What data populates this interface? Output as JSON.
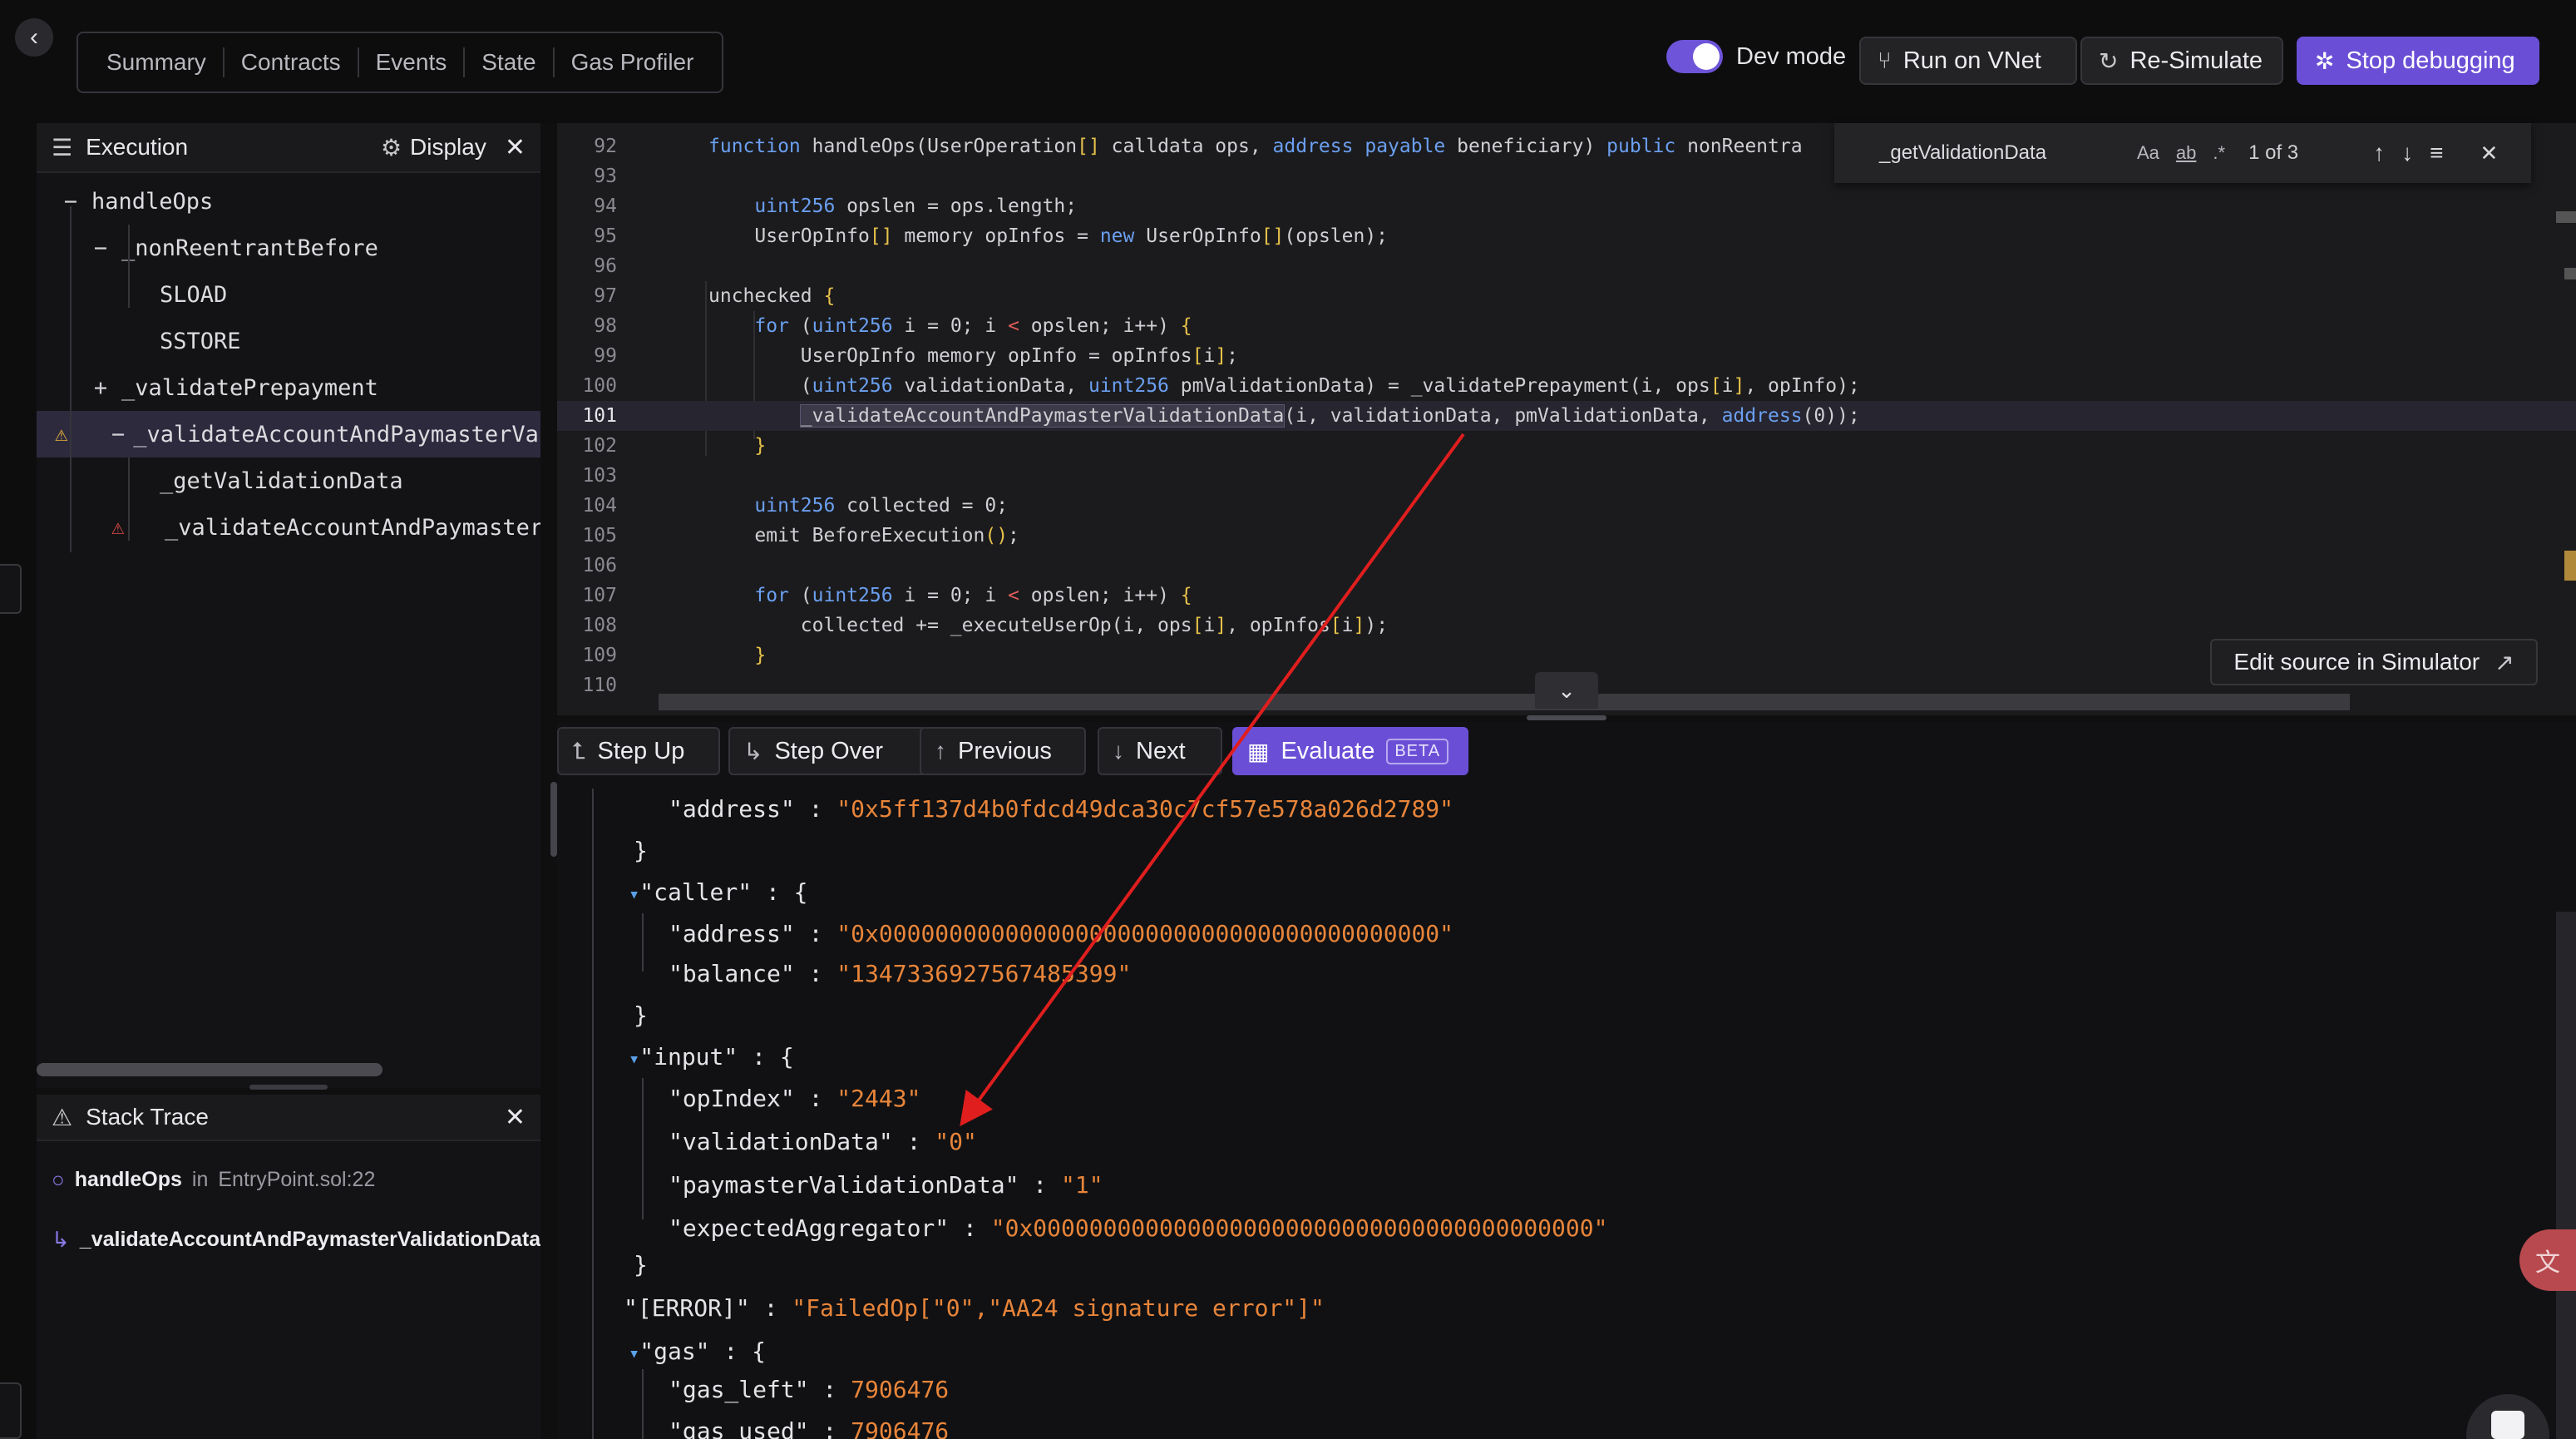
{
  "tabs": [
    "Summary",
    "Contracts",
    "Events",
    "State",
    "Gas Profiler"
  ],
  "dev_mode": {
    "label": "Dev mode",
    "enabled": true
  },
  "actions": {
    "run_vnet": "Run on VNet",
    "resimulate": "Re-Simulate",
    "stop": "Stop debugging"
  },
  "execution": {
    "title": "Execution",
    "display": "Display",
    "tree": [
      {
        "label": "handleOps",
        "depth": 0,
        "toggle": "−",
        "warn": ""
      },
      {
        "label": "_nonReentrantBefore",
        "depth": 1,
        "toggle": "−",
        "warn": ""
      },
      {
        "label": "SLOAD",
        "depth": 2,
        "toggle": "",
        "warn": ""
      },
      {
        "label": "SSTORE",
        "depth": 2,
        "toggle": "",
        "warn": ""
      },
      {
        "label": "_validatePrepayment",
        "depth": 1,
        "toggle": "+",
        "warn": ""
      },
      {
        "label": "_validateAccountAndPaymasterValidationData",
        "depth": 1,
        "toggle": "−",
        "warn": "yellow",
        "selected": true
      },
      {
        "label": "_getValidationData",
        "depth": 2,
        "toggle": "",
        "warn": ""
      },
      {
        "label": "_validateAccountAndPaymasterValidationData",
        "depth": 2,
        "toggle": "",
        "warn": "red"
      }
    ]
  },
  "stack_trace": {
    "title": "Stack Trace",
    "items": [
      {
        "fn": "handleOps",
        "in": "in",
        "loc": "EntryPoint.sol:22"
      },
      {
        "fn": "_validateAccountAndPaymasterValidationData",
        "in": "in",
        "loc": ""
      }
    ]
  },
  "find": {
    "query": "_getValidationData",
    "opt_case": "Aa",
    "opt_word": "ab",
    "opt_regex": ".*",
    "count": "1 of 3"
  },
  "code": {
    "current_line": "101",
    "lines": [
      {
        "n": "92"
      },
      {
        "n": "93"
      },
      {
        "n": "94"
      },
      {
        "n": "95"
      },
      {
        "n": "96"
      },
      {
        "n": "97"
      },
      {
        "n": "98"
      },
      {
        "n": "99"
      },
      {
        "n": "100"
      },
      {
        "n": "101"
      },
      {
        "n": "102"
      },
      {
        "n": "103"
      },
      {
        "n": "104"
      },
      {
        "n": "105"
      },
      {
        "n": "106"
      },
      {
        "n": "107"
      },
      {
        "n": "108"
      },
      {
        "n": "109"
      },
      {
        "n": "110"
      }
    ]
  },
  "edit_source": "Edit source in Simulator",
  "debug_buttons": {
    "step_up": "Step Up",
    "step_over": "Step Over",
    "previous": "Previous",
    "next": "Next",
    "evaluate": "Evaluate",
    "beta": "BETA"
  },
  "json": {
    "address1": "\"0x5ff137d4b0fdcd49dca30c7cf57e578a026d2789\"",
    "caller_key": "\"caller\"",
    "caller_address": "\"0x0000000000000000000000000000000000000000\"",
    "caller_balance": "\"1347336927567485399\"",
    "input_key": "\"input\"",
    "op_index": "\"2443\"",
    "validation_data": "\"0\"",
    "paymaster_validation_data": "\"1\"",
    "expected_aggregator": "\"0x0000000000000000000000000000000000000000\"",
    "error_key": "\"[ERROR]\"",
    "error_value": "\"FailedOp[\"0\",\"AA24 signature error\"]\"",
    "gas_key": "\"gas\"",
    "gas_left": "7906476",
    "gas_used": "7906476"
  },
  "colors": {
    "accent": "#6a4fd6",
    "string": "#e8853a",
    "keyword": "#6b9ff0",
    "arrow": "#e01e1e"
  }
}
